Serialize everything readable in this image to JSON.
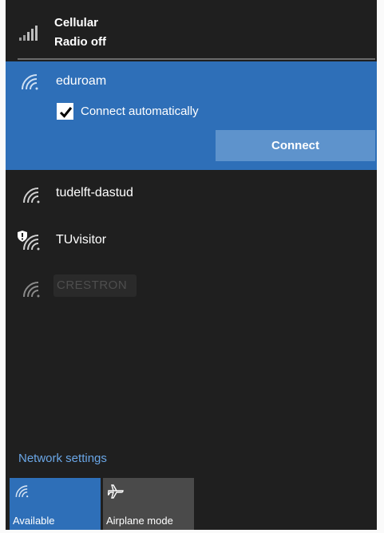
{
  "cellular": {
    "title": "Cellular",
    "status": "Radio off",
    "icon": "cellular-signal-icon"
  },
  "selected_network": {
    "name": "eduroam",
    "icon": "wifi-icon",
    "connect_auto_label": "Connect automatically",
    "connect_auto_checked": true,
    "connect_button_label": "Connect"
  },
  "networks": [
    {
      "name": "tudelft-dastud",
      "icon": "wifi-icon",
      "secured_warning": false
    },
    {
      "name": "TUvisitor",
      "icon": "wifi-icon",
      "secured_warning": true
    },
    {
      "name": "CRESTRON",
      "icon": "wifi-icon",
      "secured_warning": false
    }
  ],
  "footer": {
    "settings_link": "Network settings",
    "tiles": [
      {
        "label": "Available",
        "icon": "wifi-icon",
        "active": true
      },
      {
        "label": "Airplane mode",
        "icon": "airplane-icon",
        "active": false
      }
    ]
  },
  "colors": {
    "background": "#1f1f1f",
    "accent": "#2e6fb8",
    "button": "#5e93cc",
    "link": "#6aa6e6",
    "tile_inactive": "#4a4a4a"
  }
}
